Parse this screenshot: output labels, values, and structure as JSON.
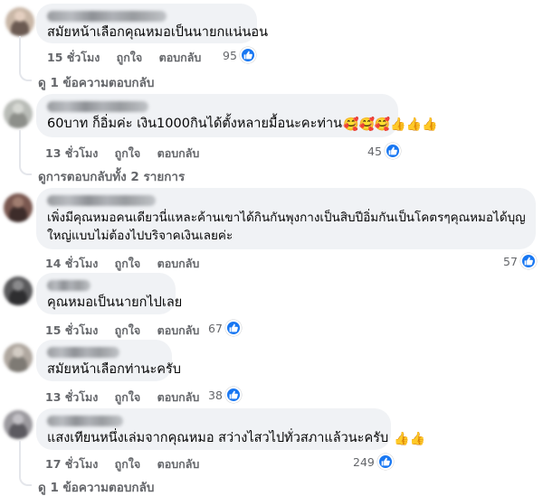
{
  "comments": [
    {
      "text": "สมัยหน้าเลือกคุณหมอเป็นนายกแน่นอน",
      "emoji": "",
      "time": "15 ชั่วโมง",
      "like_label": "ถูกใจ",
      "reply_label": "ตอบกลับ",
      "reactions": "95",
      "avatar_colors": [
        "#c9b7a7",
        "#6b5a52",
        "#e4cfc0"
      ],
      "view_replies": "ดู 1 ข้อความตอบกลับ"
    },
    {
      "text": "60บาท ก็อิ่มค่ะ เงิน1000กินได้ตั้งหลายมื้อนะคะท่าน",
      "emoji": "🥰🥰🥰👍👍👍",
      "time": "13 ชั่วโมง",
      "like_label": "ถูกใจ",
      "reply_label": "ตอบกลับ",
      "reactions": "45",
      "avatar_colors": [
        "#b9bcb7",
        "#8d8f8a",
        "#d6d8d3"
      ],
      "view_replies": "ดูการตอบกลับทั้ง 2 รายการ"
    },
    {
      "text": "เพิ่งมีคุณหมอคนเดียวนี่แหละค้านเขาได้กินกันพุงกางเป็นสิบปีอิ่มกันเป็นโคตรๆคุณหมอได้บุญใหญ่แบบไม่ต้องไปบริจาคเงินเลยค่ะ",
      "emoji": "",
      "time": "14 ชั่วโมง",
      "like_label": "ถูกใจ",
      "reply_label": "ตอบกลับ",
      "reactions": "57",
      "avatar_colors": [
        "#7a5850",
        "#3d2c2a",
        "#a07d70"
      ]
    },
    {
      "text": "คุณหมอเป็นนายกไปเลย",
      "emoji": "",
      "time": "15 ชั่วโมง",
      "like_label": "ถูกใจ",
      "reply_label": "ตอบกลับ",
      "reactions": "67",
      "avatar_colors": [
        "#5a5a5c",
        "#2e2e30",
        "#8a8a8c"
      ]
    },
    {
      "text": "สมัยหน้าเลือกท่านะครับ",
      "emoji": "",
      "time": "13 ชั่วโมง",
      "like_label": "ถูกใจ",
      "reply_label": "ตอบกลับ",
      "reactions": "38",
      "avatar_colors": [
        "#b0a8a0",
        "#7e7a74",
        "#d3ccc4"
      ]
    },
    {
      "text": "แสงเทียนหนึ่งเล่มจากคุณหมอ สว่างไสวไปทั่วสภาแล้วนะครับ",
      "emoji": "👍👍",
      "time": "17 ชั่วโมง",
      "like_label": "ถูกใจ",
      "reply_label": "ตอบกลับ",
      "reactions": "249",
      "avatar_colors": [
        "#9c9a9f",
        "#5c5a60",
        "#c3c1c6"
      ],
      "view_replies": "ดู 1 ข้อความตอบกลับ"
    }
  ],
  "accent_color": "#1877f2",
  "icons": {
    "reaction": "like-thumb-icon"
  }
}
